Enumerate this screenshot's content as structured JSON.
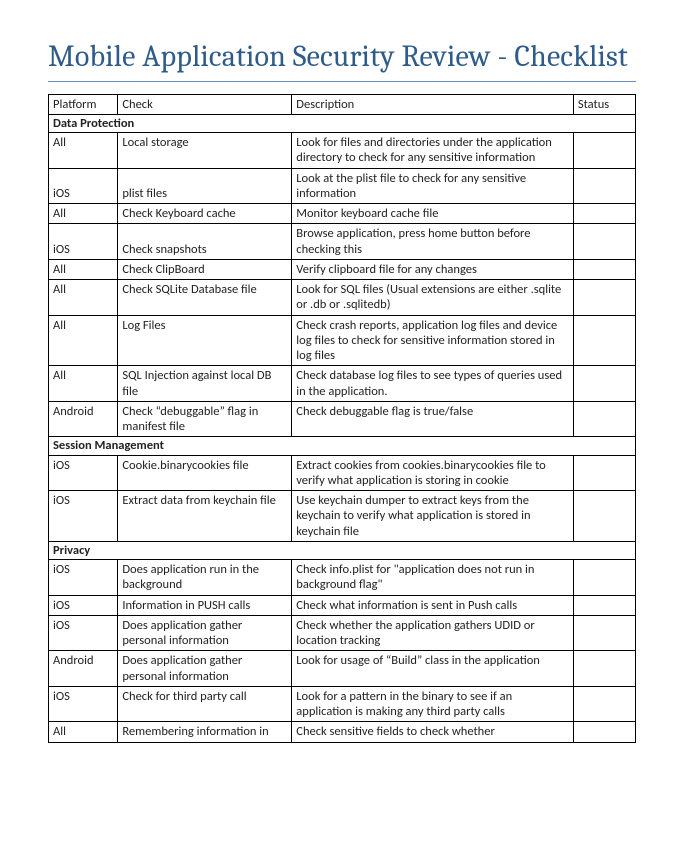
{
  "title": "Mobile Application Security Review - Checklist",
  "headers": {
    "platform": "Platform",
    "check": "Check",
    "description": "Description",
    "status": "Status"
  },
  "sections": [
    {
      "label": "Data Protection",
      "rows": [
        {
          "platform": "All",
          "check": "Local storage",
          "description": "Look for files and directories under the application directory to check for any sensitive information",
          "status": ""
        },
        {
          "platform": "iOS",
          "check": "plist files",
          "description": "Look at the plist file to check for any sensitive information",
          "status": ""
        },
        {
          "platform": "All",
          "check": "Check Keyboard cache",
          "description": "Monitor keyboard cache file",
          "status": ""
        },
        {
          "platform": "iOS",
          "check": "Check snapshots",
          "description": "Browse application, press home button before checking this",
          "status": ""
        },
        {
          "platform": "All",
          "check": "Check ClipBoard",
          "description": "Verify clipboard file for any changes",
          "status": ""
        },
        {
          "platform": "All",
          "check": "Check SQLite Database file",
          "description": "Look for SQL files (Usual extensions are either .sqlite or .db or .sqlitedb)",
          "status": ""
        },
        {
          "platform": "All",
          "check": "Log Files",
          "description": "Check crash reports, application log files and device log files to check for sensitive information stored in log files",
          "status": ""
        },
        {
          "platform": "All",
          "check": "SQL Injection against local DB file",
          "description": "Check database log files to see types of queries used in the application.",
          "status": ""
        },
        {
          "platform": "Android",
          "check": "Check “debuggable” flag in manifest file",
          "description": "Check debuggable flag is true/false",
          "status": ""
        }
      ]
    },
    {
      "label": "Session Management",
      "rows": [
        {
          "platform": "iOS",
          "check": "Cookie.binarycookies file",
          "description": "Extract cookies from cookies.binarycookies file to verify what application is storing in cookie",
          "status": ""
        },
        {
          "platform": "iOS",
          "check": "Extract data from keychain file",
          "description": "Use keychain dumper to extract keys from the keychain to verify what application is stored in keychain file",
          "status": ""
        }
      ]
    },
    {
      "label": "Privacy",
      "rows": [
        {
          "platform": "iOS",
          "check": "Does application run in the background",
          "description": "Check info.plist for \"application does not run in background flag\"",
          "status": ""
        },
        {
          "platform": "iOS",
          "check": "Information in PUSH calls",
          "description": "Check what information is sent in Push calls",
          "status": ""
        },
        {
          "platform": "iOS",
          "check": "Does application gather personal information",
          "description": "Check whether the application gathers UDID or location tracking",
          "status": ""
        },
        {
          "platform": "Android",
          "check": "Does application gather personal information",
          "description": "Look for usage of “Build” class in the application",
          "status": ""
        },
        {
          "platform": "iOS",
          "check": "Check for third party call",
          "description": "Look for a pattern in the binary to see if an application is making any third party calls",
          "status": ""
        },
        {
          "platform": "All",
          "check": "Remembering information in",
          "description": "Check sensitive fields to check whether",
          "status": ""
        }
      ]
    }
  ]
}
